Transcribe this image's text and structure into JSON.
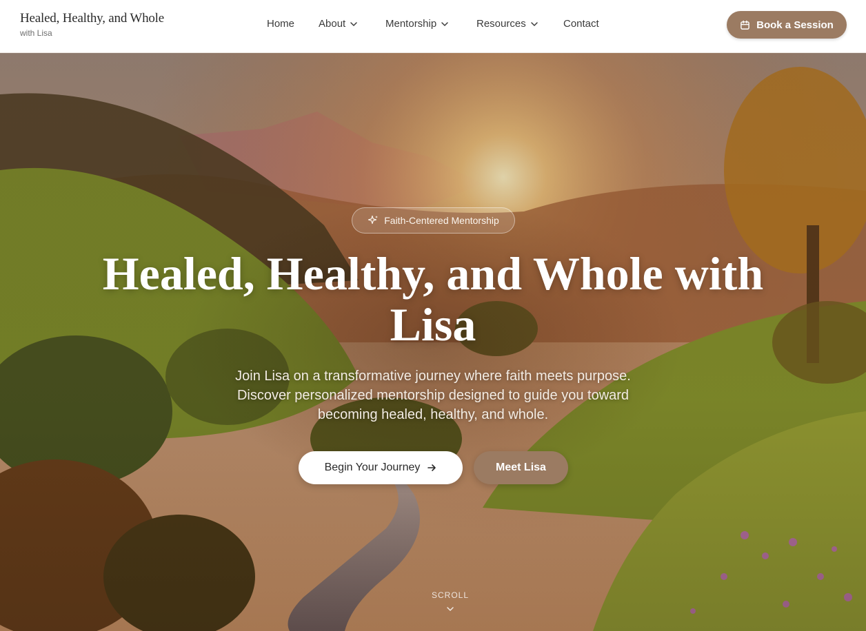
{
  "brand": {
    "title": "Healed, Healthy, and Whole",
    "subtitle": "with Lisa"
  },
  "nav": {
    "items": [
      {
        "label": "Home",
        "icon": null
      },
      {
        "label": "About",
        "icon": "chevron-down-icon"
      },
      {
        "label": "Mentorship",
        "icon": "chevron-down-icon"
      },
      {
        "label": "Resources",
        "icon": "chevron-down-icon"
      },
      {
        "label": "Contact",
        "icon": null
      }
    ],
    "cta": {
      "label": "Book a Session",
      "icon": "calendar-icon"
    }
  },
  "hero": {
    "badge": {
      "label": "Faith-Centered Mentorship",
      "icon": "sparkles-icon"
    },
    "title": "Healed, Healthy, and Whole with Lisa",
    "subtitle": "Join Lisa on a transformative journey where faith meets purpose. Discover personalized mentorship designed to guide you toward becoming healed, healthy, and whole.",
    "primary_button": {
      "label": "Begin Your Journey",
      "icon": "arrow-right-icon"
    },
    "secondary_button": {
      "label": "Meet Lisa"
    },
    "scroll": {
      "label": "SCROLL",
      "icon": "chevron-down-icon"
    }
  },
  "colors": {
    "accent": "#9b7b62",
    "nav_background": "#ffffff",
    "hero_text": "#ffffff"
  }
}
